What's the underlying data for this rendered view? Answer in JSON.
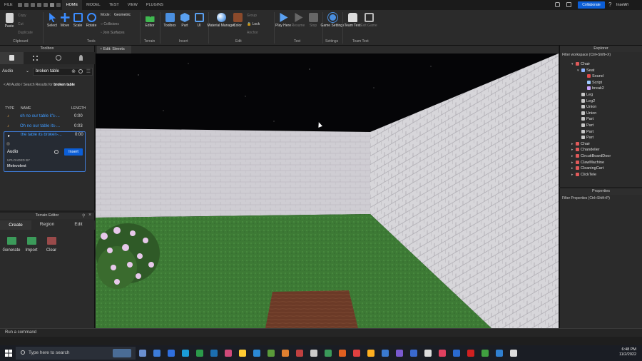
{
  "menubar": {
    "file": "FILE",
    "tabs": [
      "HOME",
      "MODEL",
      "TEST",
      "VIEW",
      "PLUGINS"
    ],
    "collaborate": "Collaborate",
    "user": "InseWi"
  },
  "ribbon": {
    "clipboard": {
      "paste": "Paste",
      "copy": "Copy",
      "cut": "Cut",
      "duplicate": "Duplicate",
      "group": "Clipboard"
    },
    "tools": {
      "select": "Select",
      "move": "Move",
      "scale": "Scale",
      "rotate": "Rotate",
      "group": "Tools"
    },
    "mode": {
      "label": "Mode:",
      "value": "Geometric",
      "collisions": "Collisions",
      "join_surfaces": "Join Surfaces"
    },
    "terrain": {
      "editor": "Editor",
      "group": "Terrain"
    },
    "insert": {
      "toolbox": "Toolbox",
      "part": "Part",
      "ui": "UI",
      "group": "Insert"
    },
    "edit": {
      "material_manager": "Material Manager",
      "color": "Color",
      "group_btn": "Group",
      "lock": "Lock",
      "anchor": "Anchor",
      "group": "Edit"
    },
    "test": {
      "play": "Play Here",
      "resume": "Resume",
      "stop": "Stop",
      "group": "Test"
    },
    "settings": {
      "game_settings": "Game Settings",
      "group": "Settings"
    },
    "team_test": {
      "team_test": "Team Test",
      "exit_game": "Exit Game",
      "group": "Team Test"
    }
  },
  "toolbox": {
    "title": "Toolbox",
    "category": "Audio",
    "search_value": "broken table",
    "breadcrumb_link": "< All Audio",
    "breadcrumb_text": " / Search Results for ",
    "breadcrumb_query": "broken table",
    "col_type": "TYPE",
    "col_name": "NAME",
    "col_length": "LENGTH",
    "results": [
      {
        "name": "oh no our table it's-...",
        "length": "0:00"
      },
      {
        "name": "Oh no our table its-...",
        "length": "0:03"
      },
      {
        "name": "the table its broken-...",
        "length": "0:00"
      }
    ],
    "detail": {
      "type": "Audio",
      "insert": "Insert",
      "uploaded_by_label": "UPLOADED BY",
      "uploader": "Melevolent"
    }
  },
  "terrain_editor": {
    "title": "Terrain Editor",
    "tabs": [
      "Create",
      "Region",
      "Edit"
    ],
    "tools": [
      "Generate",
      "Import",
      "Clear"
    ]
  },
  "document_tab": {
    "title": "Edit: Streets"
  },
  "explorer": {
    "title": "Explorer",
    "filter": "Filter workspace (Ctrl+Shift+X)",
    "items": [
      {
        "label": "Chair",
        "depth": 1,
        "arrow": "▾",
        "icon_color": "#e05a5a"
      },
      {
        "label": "Seat",
        "depth": 2,
        "arrow": "▾",
        "icon_color": "#8fb3ff"
      },
      {
        "label": "Sound",
        "depth": 3,
        "arrow": "",
        "icon_color": "#e24a4a"
      },
      {
        "label": "Script",
        "depth": 3,
        "arrow": "",
        "icon_color": "#9ecbff"
      },
      {
        "label": "break2",
        "depth": 3,
        "arrow": "",
        "icon_color": "#c9a4ff"
      },
      {
        "label": "Leg",
        "depth": 2,
        "arrow": "",
        "icon_color": "#c7c7c7"
      },
      {
        "label": "Leg2",
        "depth": 2,
        "arrow": "",
        "icon_color": "#c7c7c7"
      },
      {
        "label": "Union",
        "depth": 2,
        "arrow": "",
        "icon_color": "#c7c7c7"
      },
      {
        "label": "Union",
        "depth": 2,
        "arrow": "",
        "icon_color": "#c7c7c7"
      },
      {
        "label": "Part",
        "depth": 2,
        "arrow": "",
        "icon_color": "#c7c7c7"
      },
      {
        "label": "Part",
        "depth": 2,
        "arrow": "",
        "icon_color": "#c7c7c7"
      },
      {
        "label": "Part",
        "depth": 2,
        "arrow": "",
        "icon_color": "#c7c7c7"
      },
      {
        "label": "Part",
        "depth": 2,
        "arrow": "",
        "icon_color": "#c7c7c7"
      },
      {
        "label": "Chair",
        "depth": 1,
        "arrow": "▸",
        "icon_color": "#e05a5a"
      },
      {
        "label": "Chandelier",
        "depth": 1,
        "arrow": "▸",
        "icon_color": "#e05a5a"
      },
      {
        "label": "CircuitBoardDoor",
        "depth": 1,
        "arrow": "▸",
        "icon_color": "#e05a5a"
      },
      {
        "label": "ClawMachine",
        "depth": 1,
        "arrow": "▸",
        "icon_color": "#e05a5a"
      },
      {
        "label": "CleaningCart",
        "depth": 1,
        "arrow": "▸",
        "icon_color": "#e05a5a"
      },
      {
        "label": "ClickTele",
        "depth": 1,
        "arrow": "▸",
        "icon_color": "#e05a5a"
      }
    ]
  },
  "properties": {
    "title": "Properties",
    "filter": "Filter Properties (Ctrl+Shift+P)"
  },
  "command_bar": {
    "placeholder": "Run a command"
  },
  "taskbar": {
    "search_placeholder": "Type here to search",
    "time": "6:48 PM",
    "date": "11/2/2022"
  }
}
